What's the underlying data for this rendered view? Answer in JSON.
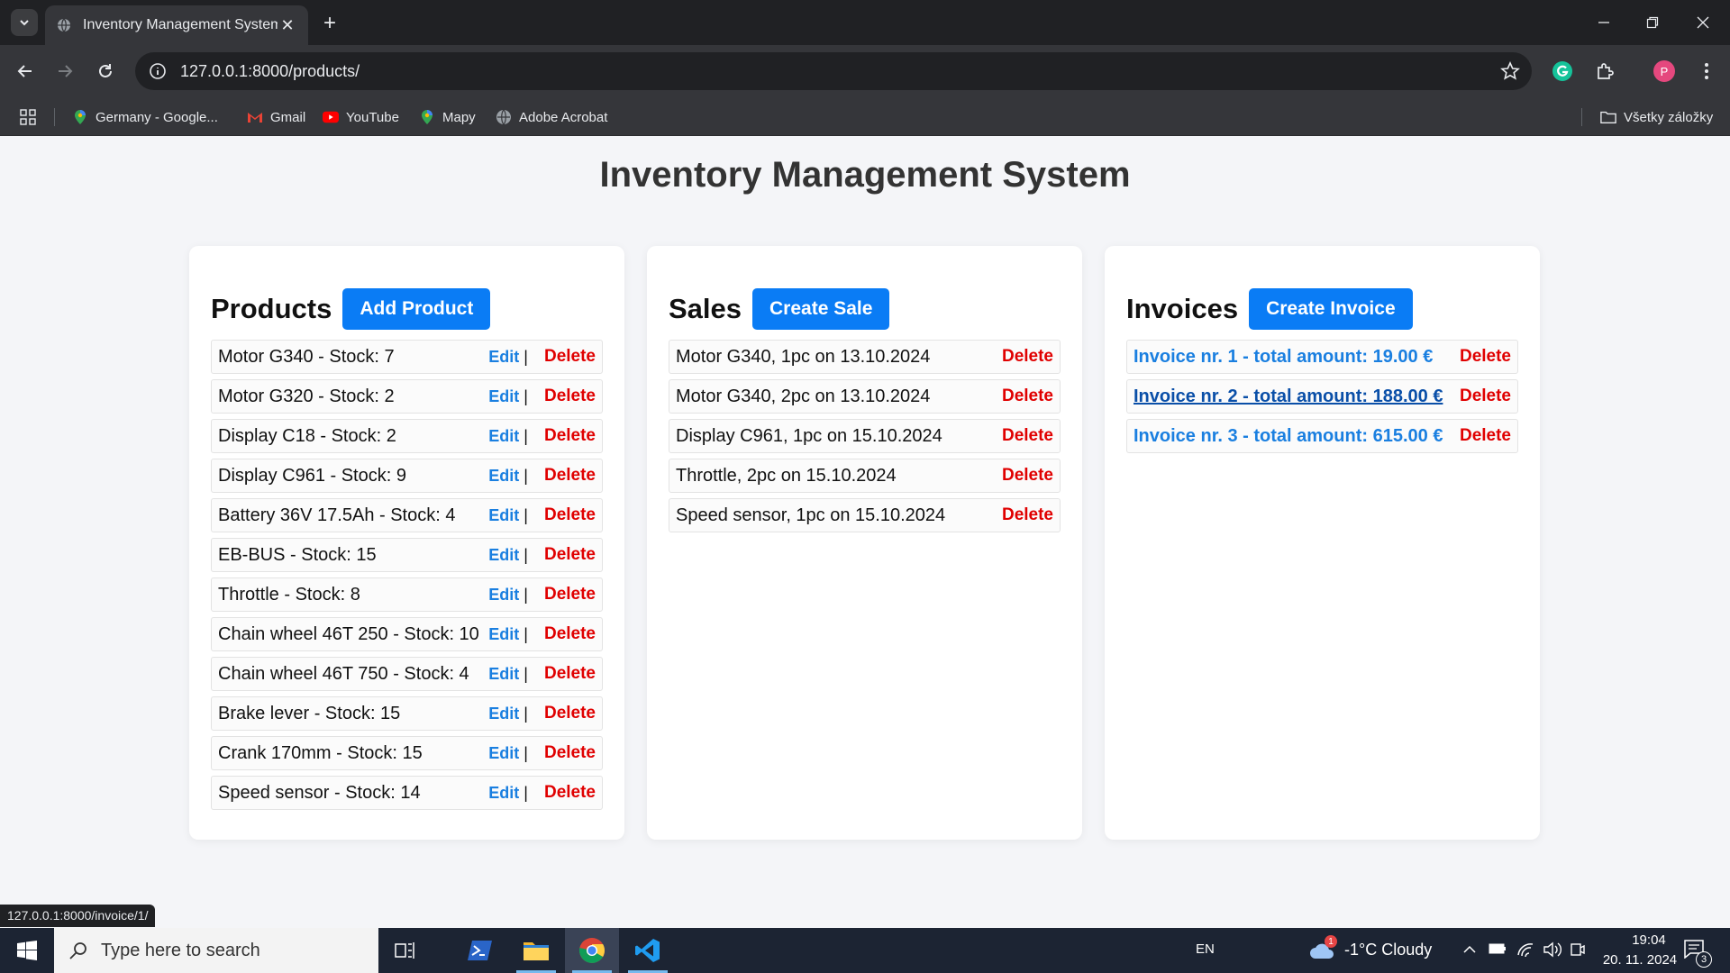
{
  "browser": {
    "tab_title": "Inventory Management System",
    "url": "127.0.0.1:8000/products/",
    "bookmarks": [
      {
        "label": "Germany - Google...",
        "icon": "maps-pin-icon"
      },
      {
        "label": "Gmail",
        "icon": "gmail-icon"
      },
      {
        "label": "YouTube",
        "icon": "youtube-icon"
      },
      {
        "label": "Mapy",
        "icon": "maps-pin-icon"
      },
      {
        "label": "Adobe Acrobat",
        "icon": "acrobat-icon"
      }
    ],
    "all_bookmarks_label": "Všetky záložky",
    "profile_initial": "P",
    "status_url": "127.0.0.1:8000/invoice/1/"
  },
  "page": {
    "title": "Inventory Management System"
  },
  "products": {
    "heading": "Products",
    "add_label": "Add Product",
    "edit_label": "Edit",
    "sep": "|",
    "delete_label": "Delete",
    "items": [
      "Motor G340 - Stock: 7",
      "Motor G320 - Stock: 2",
      "Display C18 - Stock: 2",
      "Display C961 - Stock: 9",
      "Battery 36V 17.5Ah - Stock: 4",
      "EB-BUS - Stock: 15",
      "Throttle - Stock: 8",
      "Chain wheel 46T 250 - Stock: 10",
      "Chain wheel 46T 750 - Stock: 4",
      "Brake lever - Stock: 15",
      "Crank 170mm - Stock: 15",
      "Speed sensor - Stock: 14"
    ]
  },
  "sales": {
    "heading": "Sales",
    "create_label": "Create Sale",
    "delete_label": "Delete",
    "items": [
      "Motor G340, 1pc on 13.10.2024",
      "Motor G340, 2pc on 13.10.2024",
      "Display C961, 1pc on 15.10.2024",
      "Throttle, 2pc on 15.10.2024",
      "Speed sensor, 1pc on 15.10.2024"
    ]
  },
  "invoices": {
    "heading": "Invoices",
    "create_label": "Create Invoice",
    "delete_label": "Delete",
    "items": [
      "Invoice nr. 1 - total amount: 19.00 €",
      "Invoice nr. 2 - total amount: 188.00 €",
      "Invoice nr. 3 - total amount: 615.00 €"
    ]
  },
  "taskbar": {
    "search_placeholder": "Type here to search",
    "language": "EN",
    "weather": "-1°C  Cloudy",
    "weather_badge": "1",
    "time": "19:04",
    "date": "20. 11. 2024",
    "notification_count": "3"
  },
  "colors": {
    "accent": "#0a7cf5",
    "link": "#1a7fe0",
    "danger": "#e00000"
  }
}
